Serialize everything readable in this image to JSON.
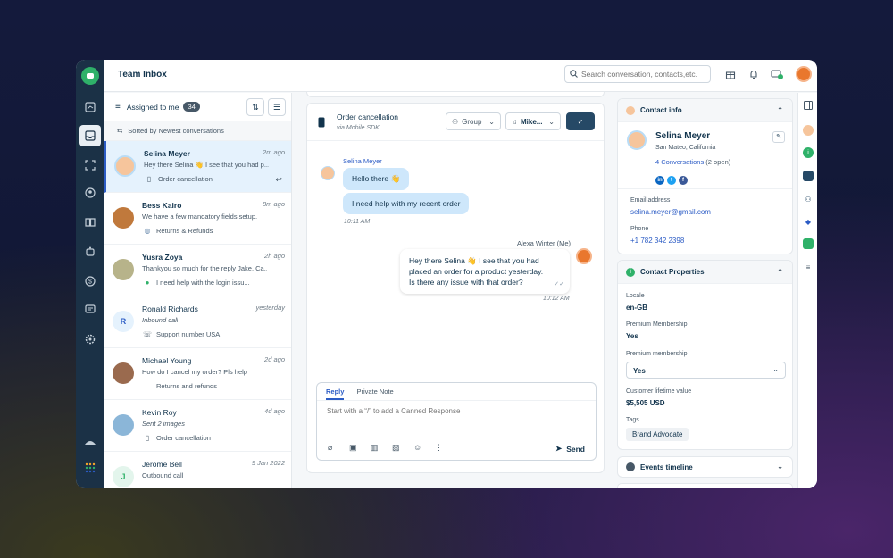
{
  "topbar": {
    "title": "Team Inbox",
    "search_placeholder": "Search conversation, contacts,etc."
  },
  "list": {
    "filter_label": "Assigned to me",
    "count": "34",
    "sorted_label": "Sorted by Newest conversations",
    "items": [
      {
        "name": "Selina Meyer",
        "time": "2m ago",
        "preview": "Hey there Selina 👋 I see that you had p...",
        "channel": "Order cancellation",
        "channel_icon": "mobile-icon"
      },
      {
        "name": "Bess Kairo",
        "time": "8m ago",
        "preview": "We have a few mandatory fields setup.",
        "channel": "Returns & Refunds",
        "channel_icon": "globe-icon"
      },
      {
        "name": "Yusra Zoya",
        "time": "2h ago",
        "preview": "Thankyou so much for the reply Jake. Ca...",
        "channel": "I need help with the login issu...",
        "channel_icon": "whatsapp-icon"
      },
      {
        "name": "Ronald Richards",
        "initial": "R",
        "time": "yesterday",
        "preview": "Inbound call",
        "channel": "Support number USA",
        "channel_icon": "phone-icon"
      },
      {
        "name": "Michael Young",
        "time": "2d ago",
        "preview": "How do I cancel my order? Pls help",
        "channel": "Returns and refunds",
        "channel_icon": "apple-icon"
      },
      {
        "name": "Kevin Roy",
        "time": "4d ago",
        "preview": "Sent 2 images",
        "channel": "Order cancellation",
        "channel_icon": "mobile-icon"
      },
      {
        "name": "Jerome Bell",
        "initial": "J",
        "time": "9 Jan 2022",
        "preview": "Outbound call",
        "channel": "",
        "channel_icon": ""
      }
    ]
  },
  "chat": {
    "title": "Order cancellation",
    "subtitle": "via Mobile SDK",
    "group_label": "Group",
    "agent_label": "Mike...",
    "customer_name": "Selina Meyer",
    "msg1": "Hello there 👋",
    "msg2": "I need help with my recent order",
    "time1": "10:11 AM",
    "agent_name": "Alexa Winter (Me)",
    "msg3_line1": "Hey there Selina 👋 I see that you had",
    "msg3_line2": "placed an order for a product yesterday.",
    "msg3_line3": "Is there any issue with that order?",
    "time2": "10:12 AM",
    "reply_tab": "Reply",
    "note_tab": "Private Note",
    "reply_placeholder": "Start with a “/” to add a Canned Response",
    "send_label": "Send"
  },
  "contact": {
    "header": "Contact info",
    "name": "Selina Meyer",
    "location": "San Mateo, California",
    "conversations_link": "4 Conversations",
    "conversations_open": "(2 open)",
    "email_label": "Email address",
    "email": "selina.meyer@gmail.com",
    "phone_label": "Phone",
    "phone": "+1 782 342 2398"
  },
  "properties": {
    "header": "Contact Properties",
    "locale_label": "Locale",
    "locale": "en-GB",
    "premium_label": "Premium Membership",
    "premium": "Yes",
    "premium2_label": "Premium membership",
    "premium2": "Yes",
    "ltv_label": "Customer lifetime value",
    "ltv": "$5,505 USD",
    "tags_label": "Tags",
    "tag": "Brand Advocate"
  },
  "events": {
    "header": "Events timeline"
  },
  "colors": {
    "accent": "#2c5cc5",
    "rail": "#1b3146",
    "green": "#2fb169"
  }
}
